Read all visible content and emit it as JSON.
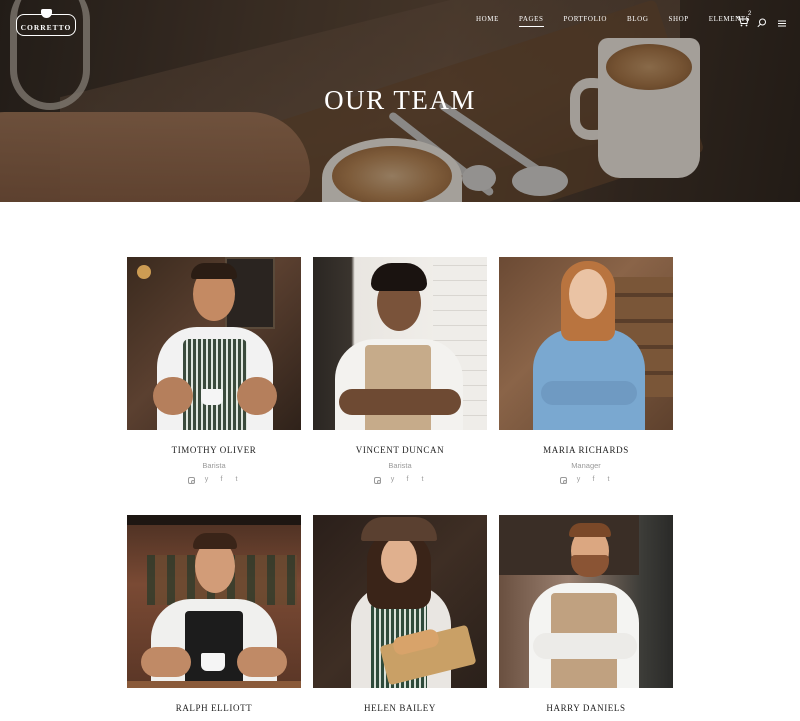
{
  "header": {
    "logo_text": "CORRETTO",
    "nav": [
      {
        "label": "HOME",
        "active": false
      },
      {
        "label": "PAGES",
        "active": true
      },
      {
        "label": "PORTFOLIO",
        "active": false
      },
      {
        "label": "BLOG",
        "active": false
      },
      {
        "label": "SHOP",
        "active": false
      },
      {
        "label": "ELEMENTS",
        "active": false
      }
    ],
    "cart_count": "2",
    "icons": [
      "cart-icon",
      "search-icon",
      "menu-icon"
    ]
  },
  "hero": {
    "title": "OUR TEAM"
  },
  "team": [
    {
      "name": "TIMOTHY OLIVER",
      "role": "Barista",
      "socials": [
        "instagram-icon",
        "twitter-icon",
        "facebook-icon",
        "tumblr-icon"
      ]
    },
    {
      "name": "VINCENT DUNCAN",
      "role": "Barista",
      "socials": [
        "instagram-icon",
        "twitter-icon",
        "facebook-icon",
        "tumblr-icon"
      ]
    },
    {
      "name": "MARIA RICHARDS",
      "role": "Manager",
      "socials": [
        "instagram-icon",
        "twitter-icon",
        "facebook-icon",
        "tumblr-icon"
      ]
    },
    {
      "name": "RALPH ELLIOTT",
      "role": "",
      "socials": []
    },
    {
      "name": "HELEN BAILEY",
      "role": "",
      "socials": []
    },
    {
      "name": "HARRY DANIELS",
      "role": "",
      "socials": []
    }
  ],
  "social_glyphs": {
    "twitter": "y",
    "facebook": "f",
    "tumblr": "t"
  }
}
